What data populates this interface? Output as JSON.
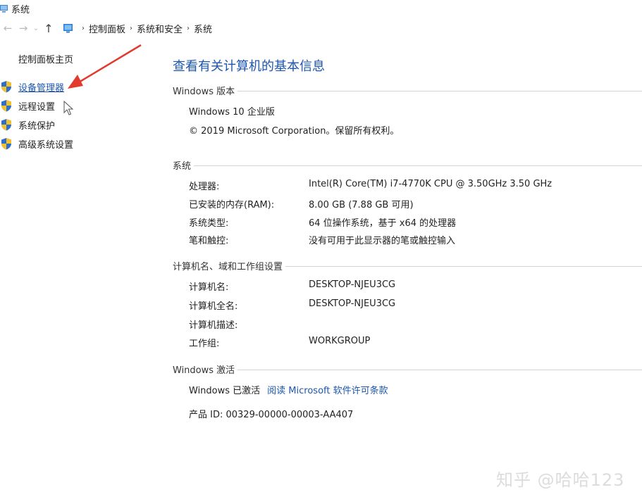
{
  "window": {
    "title": "系统"
  },
  "addressbar": {
    "back_icon": "←",
    "forward_icon": "→",
    "history_icon": "⌄",
    "up_icon": "↑",
    "breadcrumbs": [
      "控制面板",
      "系统和安全",
      "系统"
    ],
    "separator": "›"
  },
  "sidebar": {
    "home": "控制面板主页",
    "links": [
      {
        "label": "设备管理器"
      },
      {
        "label": "远程设置"
      },
      {
        "label": "系统保护"
      },
      {
        "label": "高级系统设置"
      }
    ]
  },
  "main": {
    "title": "查看有关计算机的基本信息",
    "windows_edition": {
      "header": "Windows 版本",
      "edition": "Windows 10 企业版",
      "copyright": "© 2019 Microsoft Corporation。保留所有权利。"
    },
    "system": {
      "header": "系统",
      "rows": [
        {
          "key": "处理器:",
          "value": "Intel(R) Core(TM) i7-4770K CPU @ 3.50GHz   3.50 GHz"
        },
        {
          "key": "已安装的内存(RAM):",
          "value": "8.00 GB (7.88 GB 可用)"
        },
        {
          "key": "系统类型:",
          "value": "64 位操作系统，基于 x64 的处理器"
        },
        {
          "key": "笔和触控:",
          "value": "没有可用于此显示器的笔或触控输入"
        }
      ]
    },
    "computer_name": {
      "header": "计算机名、域和工作组设置",
      "rows": [
        {
          "key": "计算机名:",
          "value": "DESKTOP-NJEU3CG"
        },
        {
          "key": "计算机全名:",
          "value": "DESKTOP-NJEU3CG"
        },
        {
          "key": "计算机描述:",
          "value": ""
        },
        {
          "key": "工作组:",
          "value": "WORKGROUP"
        }
      ]
    },
    "activation": {
      "header": "Windows 激活",
      "status": "Windows 已激活",
      "license_link": "阅读 Microsoft 软件许可条款",
      "product_id": "产品 ID: 00329-00000-00003-AA407"
    }
  },
  "watermark": "知乎 @哈哈123",
  "colors": {
    "link": "#1d56b0",
    "arrow": "#e23b2e",
    "rule": "#d4d4d4"
  }
}
